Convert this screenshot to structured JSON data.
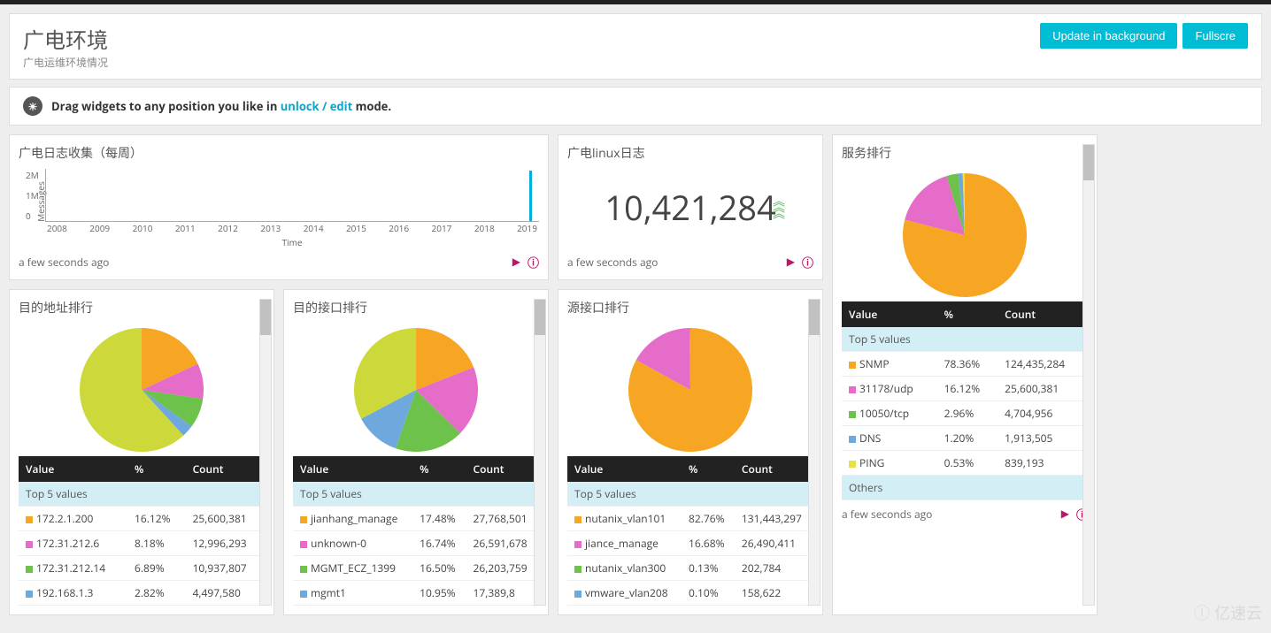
{
  "page": {
    "title": "广电环境",
    "subtitle": "广电运维环境情况"
  },
  "actions": {
    "update_bg": "Update in background",
    "fullscreen": "Fullscre"
  },
  "drag_hint": {
    "pre": "Drag widgets to any position you like in ",
    "link": "unlock / edit",
    "post": " mode."
  },
  "footer_time": "a few seconds ago",
  "widgets": {
    "histogram": {
      "title": "广电日志收集（每周）",
      "ylabel": "Messages",
      "xlabel": "Time"
    },
    "counter": {
      "title": "广电linux日志",
      "value": "10,421,284"
    },
    "service": {
      "title": "服务排行"
    },
    "dest_addr": {
      "title": "目的地址排行"
    },
    "dest_port": {
      "title": "目的接口排行"
    },
    "src_port": {
      "title": "源接口排行"
    }
  },
  "table": {
    "headers": {
      "value": "Value",
      "pct": "%",
      "count": "Count"
    },
    "top5": "Top 5 values",
    "others": "Others"
  },
  "chart_data": {
    "histogram": {
      "type": "bar",
      "yticks": [
        "2M",
        "1M",
        "0"
      ],
      "xticks": [
        "2008",
        "2009",
        "2010",
        "2011",
        "2012",
        "2013",
        "2014",
        "2015",
        "2016",
        "2017",
        "2018",
        "2019"
      ],
      "bars": [
        {
          "x_frac": 0.98,
          "h_frac": 0.95
        }
      ]
    },
    "counter": {
      "type": "number",
      "value": 10421284
    },
    "service": {
      "type": "pie",
      "series": [
        {
          "name": "SNMP",
          "pct": "78.36%",
          "count": "124,435,284",
          "color": "#f6a623"
        },
        {
          "name": "31178/udp",
          "pct": "16.12%",
          "count": "25,600,381",
          "color": "#e66cc9"
        },
        {
          "name": "10050/tcp",
          "pct": "2.96%",
          "count": "4,704,956",
          "color": "#6cc24a"
        },
        {
          "name": "DNS",
          "pct": "1.20%",
          "count": "1,913,505",
          "color": "#6fa8dc"
        },
        {
          "name": "PING",
          "pct": "0.53%",
          "count": "839,193",
          "color": "#e6e24a"
        }
      ]
    },
    "dest_addr": {
      "type": "pie",
      "series": [
        {
          "name": "172.2.1.200",
          "pct": "16.12%",
          "count": "25,600,381",
          "color": "#f6a623"
        },
        {
          "name": "172.31.212.6",
          "pct": "8.18%",
          "count": "12,996,293",
          "color": "#e66cc9"
        },
        {
          "name": "172.31.212.14",
          "pct": "6.89%",
          "count": "10,937,807",
          "color": "#6cc24a"
        },
        {
          "name": "192.168.1.3",
          "pct": "2.82%",
          "count": "4,497,580",
          "color": "#6fa8dc"
        }
      ],
      "others_pct": 55
    },
    "dest_port": {
      "type": "pie",
      "series": [
        {
          "name": "jianhang_manage",
          "pct": "17.48%",
          "count": "27,768,501",
          "color": "#f6a623"
        },
        {
          "name": "unknown-0",
          "pct": "16.74%",
          "count": "26,591,678",
          "color": "#e66cc9"
        },
        {
          "name": "MGMT_ECZ_1399",
          "pct": "16.50%",
          "count": "26,203,759",
          "color": "#6cc24a"
        },
        {
          "name": "mgmt1",
          "pct": "10.95%",
          "count": "17,389,8",
          "color": "#6fa8dc"
        }
      ],
      "others_pct": 30
    },
    "src_port": {
      "type": "pie",
      "series": [
        {
          "name": "nutanix_vlan101",
          "pct": "82.76%",
          "count": "131,443,297",
          "color": "#f6a623"
        },
        {
          "name": "jiance_manage",
          "pct": "16.68%",
          "count": "26,490,411",
          "color": "#e66cc9"
        },
        {
          "name": "nutanix_vlan300",
          "pct": "0.13%",
          "count": "202,784",
          "color": "#6cc24a"
        },
        {
          "name": "vmware_vlan208",
          "pct": "0.10%",
          "count": "158,622",
          "color": "#6fa8dc"
        }
      ]
    }
  }
}
